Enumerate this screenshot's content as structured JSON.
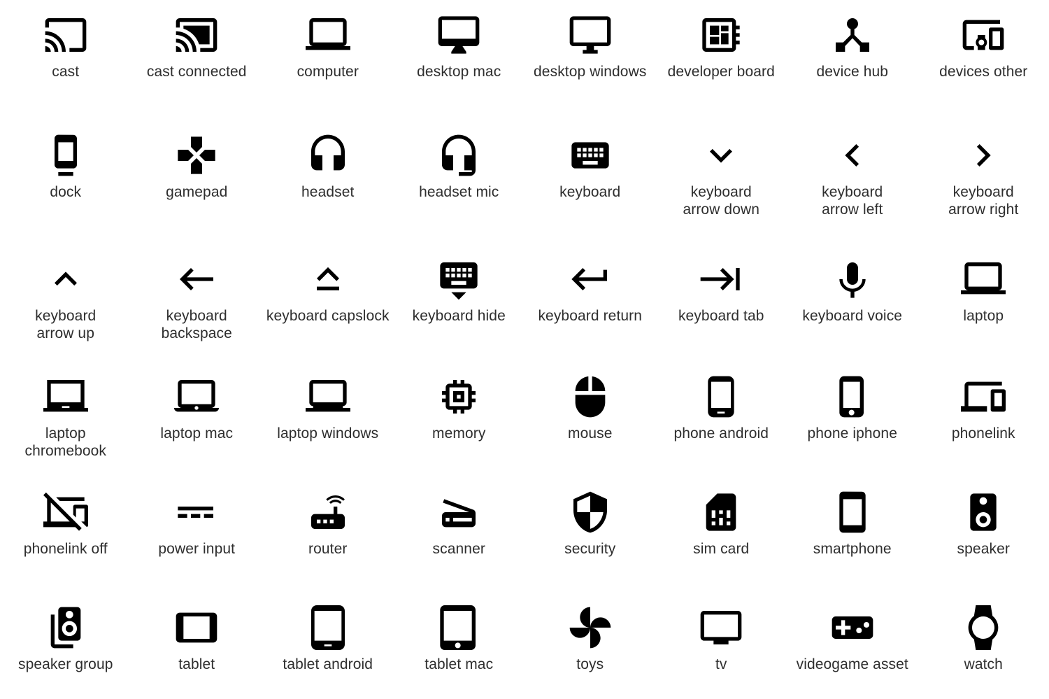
{
  "page": {
    "background_color": "#ffffff",
    "icon_color": "#000000",
    "label_color": "#2e2e2e",
    "columns": 8,
    "rows": 6,
    "total_icons": 48
  },
  "icons": [
    {
      "id": "cast",
      "label": "cast"
    },
    {
      "id": "cast-connected",
      "label": "cast connected"
    },
    {
      "id": "computer",
      "label": "computer"
    },
    {
      "id": "desktop-mac",
      "label": "desktop mac"
    },
    {
      "id": "desktop-windows",
      "label": "desktop windows"
    },
    {
      "id": "developer-board",
      "label": "developer board"
    },
    {
      "id": "device-hub",
      "label": "device hub"
    },
    {
      "id": "devices-other",
      "label": "devices other"
    },
    {
      "id": "dock",
      "label": "dock"
    },
    {
      "id": "gamepad",
      "label": "gamepad"
    },
    {
      "id": "headset",
      "label": "headset"
    },
    {
      "id": "headset-mic",
      "label": "headset mic"
    },
    {
      "id": "keyboard",
      "label": "keyboard"
    },
    {
      "id": "keyboard-arrow-down",
      "label": "keyboard\narrow down"
    },
    {
      "id": "keyboard-arrow-left",
      "label": "keyboard\narrow left"
    },
    {
      "id": "keyboard-arrow-right",
      "label": "keyboard\narrow right"
    },
    {
      "id": "keyboard-arrow-up",
      "label": "keyboard\narrow up"
    },
    {
      "id": "keyboard-backspace",
      "label": "keyboard\nbackspace"
    },
    {
      "id": "keyboard-capslock",
      "label": "keyboard capslock"
    },
    {
      "id": "keyboard-hide",
      "label": "keyboard hide"
    },
    {
      "id": "keyboard-return",
      "label": "keyboard return"
    },
    {
      "id": "keyboard-tab",
      "label": "keyboard tab"
    },
    {
      "id": "keyboard-voice",
      "label": "keyboard voice"
    },
    {
      "id": "laptop",
      "label": "laptop"
    },
    {
      "id": "laptop-chromebook",
      "label": "laptop\nchromebook"
    },
    {
      "id": "laptop-mac",
      "label": "laptop mac"
    },
    {
      "id": "laptop-windows",
      "label": "laptop windows"
    },
    {
      "id": "memory",
      "label": "memory"
    },
    {
      "id": "mouse",
      "label": "mouse"
    },
    {
      "id": "phone-android",
      "label": "phone android"
    },
    {
      "id": "phone-iphone",
      "label": "phone iphone"
    },
    {
      "id": "phonelink",
      "label": "phonelink"
    },
    {
      "id": "phonelink-off",
      "label": "phonelink off"
    },
    {
      "id": "power-input",
      "label": "power input"
    },
    {
      "id": "router",
      "label": "router"
    },
    {
      "id": "scanner",
      "label": "scanner"
    },
    {
      "id": "security",
      "label": "security"
    },
    {
      "id": "sim-card",
      "label": "sim card"
    },
    {
      "id": "smartphone",
      "label": "smartphone"
    },
    {
      "id": "speaker",
      "label": "speaker"
    },
    {
      "id": "speaker-group",
      "label": "speaker group"
    },
    {
      "id": "tablet",
      "label": "tablet"
    },
    {
      "id": "tablet-android",
      "label": "tablet android"
    },
    {
      "id": "tablet-mac",
      "label": "tablet mac"
    },
    {
      "id": "toys",
      "label": "toys"
    },
    {
      "id": "tv",
      "label": "tv"
    },
    {
      "id": "videogame-asset",
      "label": "videogame asset"
    },
    {
      "id": "watch",
      "label": "watch"
    }
  ]
}
